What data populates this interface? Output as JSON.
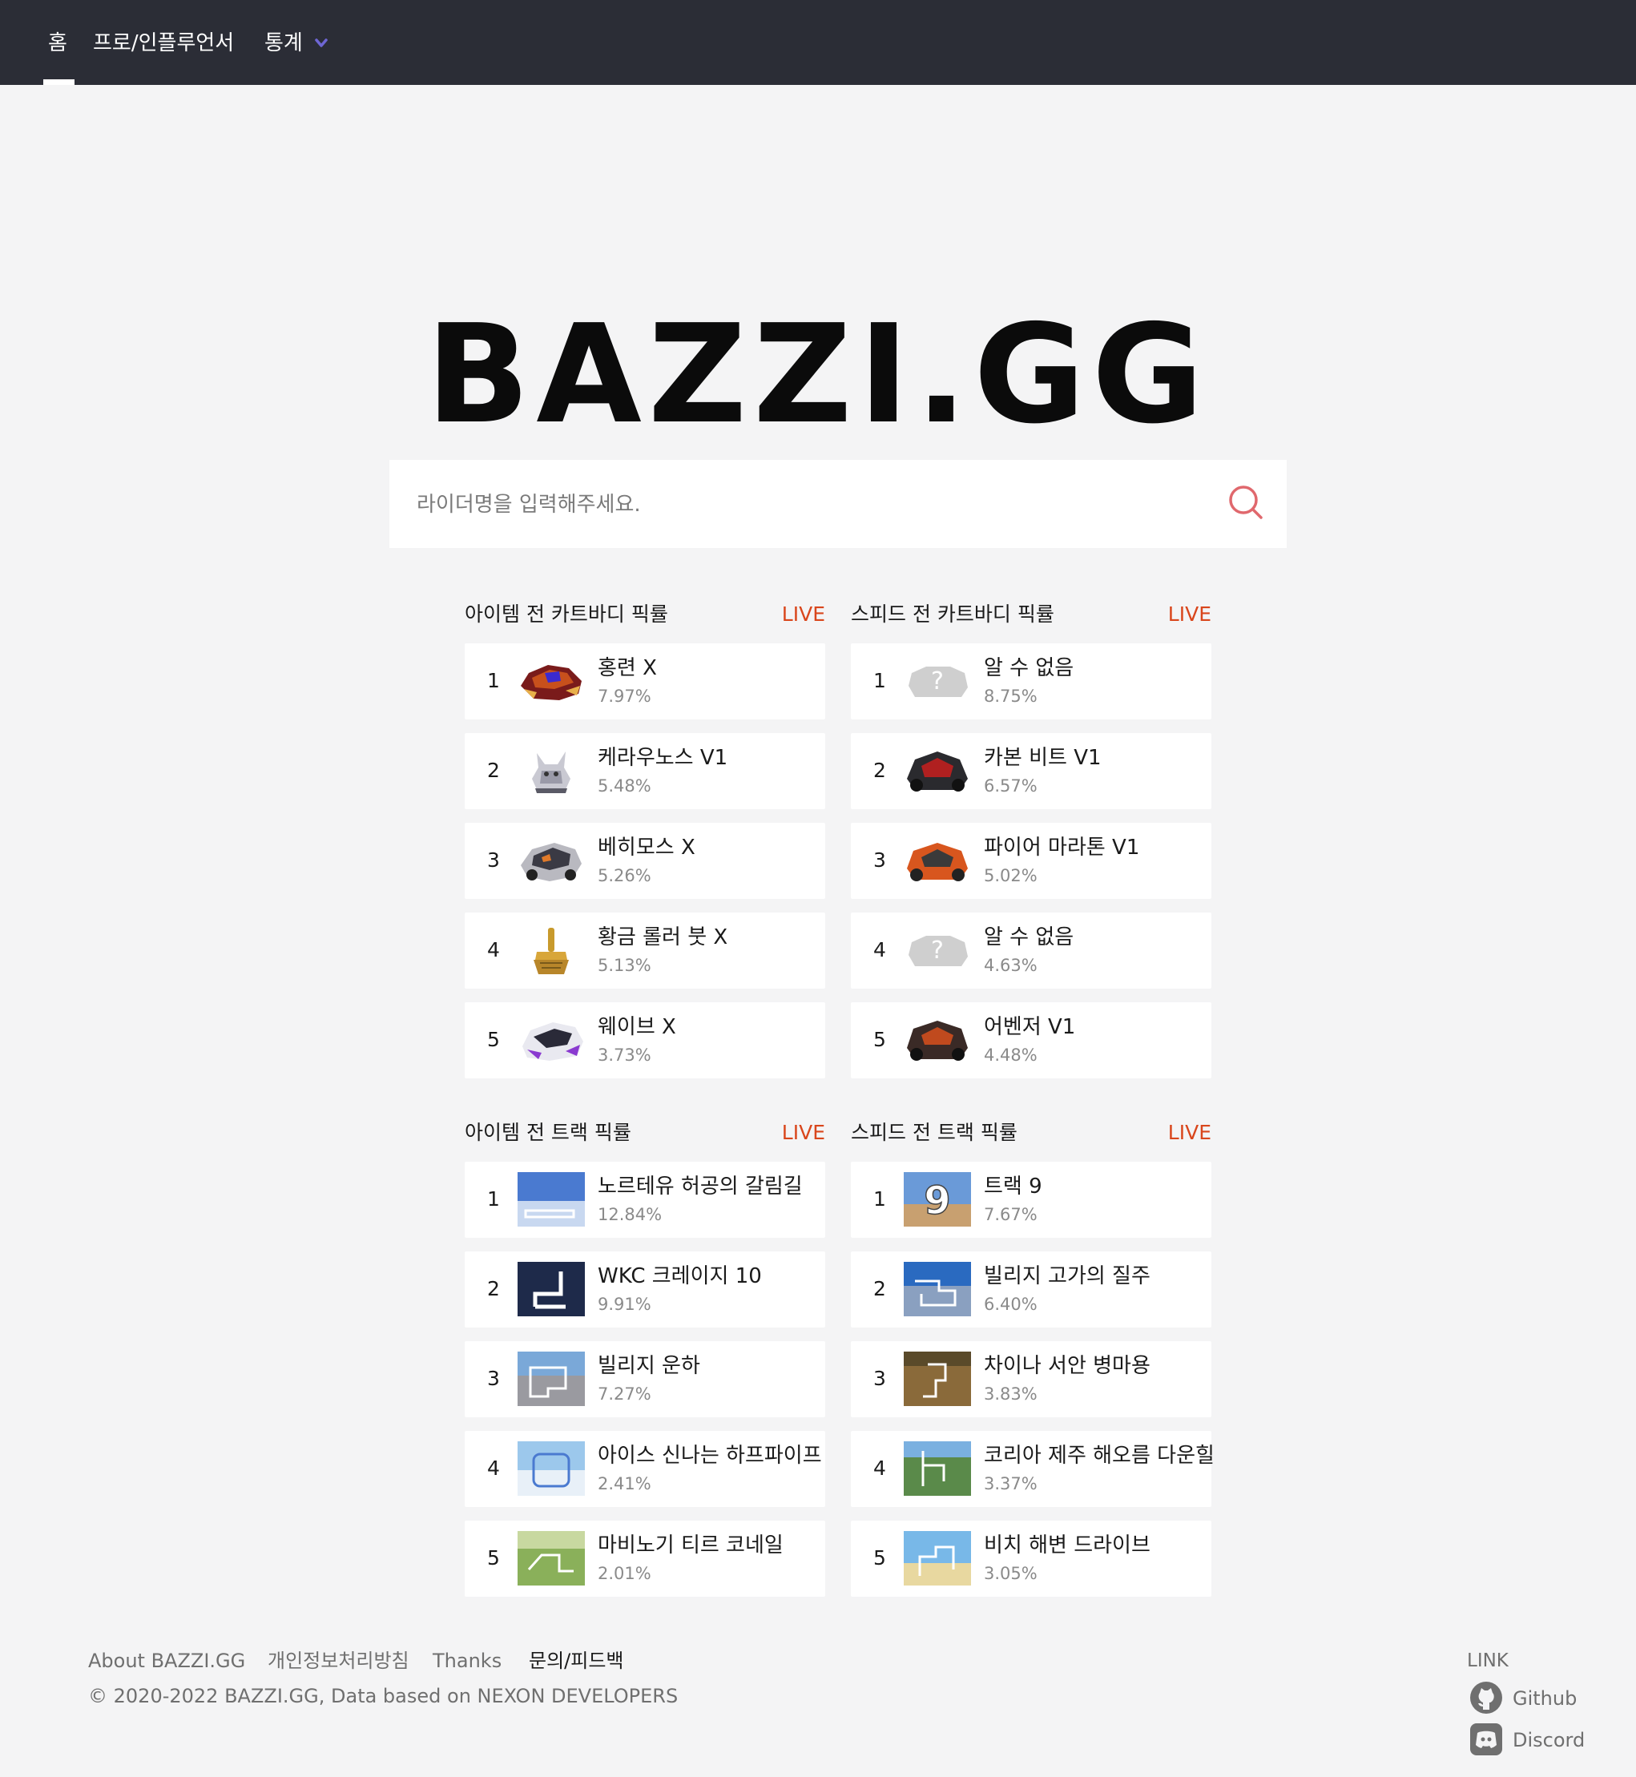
{
  "nav": {
    "home": "홈",
    "pro": "프로/인플루언서",
    "stats": "통계"
  },
  "logo": "BAZZI.GG",
  "search": {
    "placeholder": "라이더명을 입력해주세요."
  },
  "live_label": "LIVE",
  "sections": [
    {
      "title": "아이템 전 카트바디 픽률",
      "rows": [
        {
          "rank": "1",
          "name": "홍련 X",
          "pct": "7.97%"
        },
        {
          "rank": "2",
          "name": "케라우노스 V1",
          "pct": "5.48%"
        },
        {
          "rank": "3",
          "name": "베히모스 X",
          "pct": "5.26%"
        },
        {
          "rank": "4",
          "name": "황금 롤러 붓 X",
          "pct": "5.13%"
        },
        {
          "rank": "5",
          "name": "웨이브 X",
          "pct": "3.73%"
        }
      ]
    },
    {
      "title": "스피드 전 카트바디 픽률",
      "rows": [
        {
          "rank": "1",
          "name": "알 수 없음",
          "pct": "8.75%"
        },
        {
          "rank": "2",
          "name": "카본 비트 V1",
          "pct": "6.57%"
        },
        {
          "rank": "3",
          "name": "파이어 마라톤 V1",
          "pct": "5.02%"
        },
        {
          "rank": "4",
          "name": "알 수 없음",
          "pct": "4.63%"
        },
        {
          "rank": "5",
          "name": "어벤저 V1",
          "pct": "4.48%"
        }
      ]
    },
    {
      "title": "아이템 전 트랙 픽률",
      "rows": [
        {
          "rank": "1",
          "name": "노르테유 허공의 갈림길",
          "pct": "12.84%"
        },
        {
          "rank": "2",
          "name": "WKC 크레이지 10",
          "pct": "9.91%"
        },
        {
          "rank": "3",
          "name": "빌리지 운하",
          "pct": "7.27%"
        },
        {
          "rank": "4",
          "name": "아이스 신나는 하프파이프",
          "pct": "2.41%"
        },
        {
          "rank": "5",
          "name": "마비노기 티르 코네일",
          "pct": "2.01%"
        }
      ]
    },
    {
      "title": "스피드 전 트랙 픽률",
      "rows": [
        {
          "rank": "1",
          "name": "트랙 9",
          "pct": "7.67%"
        },
        {
          "rank": "2",
          "name": "빌리지 고가의 질주",
          "pct": "6.40%"
        },
        {
          "rank": "3",
          "name": "차이나 서안 병마용",
          "pct": "3.83%"
        },
        {
          "rank": "4",
          "name": "코리아 제주 해오름 다운힐",
          "pct": "3.37%"
        },
        {
          "rank": "5",
          "name": "비치 해변 드라이브",
          "pct": "3.05%"
        }
      ]
    }
  ],
  "footer": {
    "about": "About BAZZI.GG",
    "privacy": "개인정보처리방침",
    "thanks": "Thanks",
    "feedback": "문의/피드백",
    "copyright": "© 2020-2022 BAZZI.GG, Data based on NEXON DEVELOPERS",
    "link_label": "LINK",
    "github": "Github",
    "discord": "Discord"
  },
  "colors": {
    "topbar": "#2b2d36",
    "live": "#d9461c",
    "search_icon": "#e0686d",
    "chevron": "#6e66d4"
  }
}
